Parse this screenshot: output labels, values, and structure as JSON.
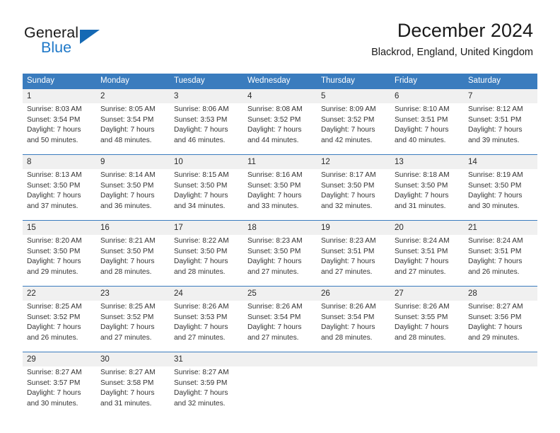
{
  "brand": {
    "name_top": "General",
    "name_bottom": "Blue",
    "accent_color": "#1569b4",
    "logo_icon": "triangle-icon"
  },
  "header": {
    "title": "December 2024",
    "subtitle": "Blackrod, England, United Kingdom"
  },
  "theme": {
    "header_blue": "#3a7cbe",
    "daynum_band": "#f0f0f0",
    "text": "#333333"
  },
  "calendar": {
    "day_headers": [
      "Sunday",
      "Monday",
      "Tuesday",
      "Wednesday",
      "Thursday",
      "Friday",
      "Saturday"
    ],
    "weeks": [
      [
        {
          "day": "1",
          "sunrise": "Sunrise: 8:03 AM",
          "sunset": "Sunset: 3:54 PM",
          "daylight_1": "Daylight: 7 hours",
          "daylight_2": "and 50 minutes."
        },
        {
          "day": "2",
          "sunrise": "Sunrise: 8:05 AM",
          "sunset": "Sunset: 3:54 PM",
          "daylight_1": "Daylight: 7 hours",
          "daylight_2": "and 48 minutes."
        },
        {
          "day": "3",
          "sunrise": "Sunrise: 8:06 AM",
          "sunset": "Sunset: 3:53 PM",
          "daylight_1": "Daylight: 7 hours",
          "daylight_2": "and 46 minutes."
        },
        {
          "day": "4",
          "sunrise": "Sunrise: 8:08 AM",
          "sunset": "Sunset: 3:52 PM",
          "daylight_1": "Daylight: 7 hours",
          "daylight_2": "and 44 minutes."
        },
        {
          "day": "5",
          "sunrise": "Sunrise: 8:09 AM",
          "sunset": "Sunset: 3:52 PM",
          "daylight_1": "Daylight: 7 hours",
          "daylight_2": "and 42 minutes."
        },
        {
          "day": "6",
          "sunrise": "Sunrise: 8:10 AM",
          "sunset": "Sunset: 3:51 PM",
          "daylight_1": "Daylight: 7 hours",
          "daylight_2": "and 40 minutes."
        },
        {
          "day": "7",
          "sunrise": "Sunrise: 8:12 AM",
          "sunset": "Sunset: 3:51 PM",
          "daylight_1": "Daylight: 7 hours",
          "daylight_2": "and 39 minutes."
        }
      ],
      [
        {
          "day": "8",
          "sunrise": "Sunrise: 8:13 AM",
          "sunset": "Sunset: 3:50 PM",
          "daylight_1": "Daylight: 7 hours",
          "daylight_2": "and 37 minutes."
        },
        {
          "day": "9",
          "sunrise": "Sunrise: 8:14 AM",
          "sunset": "Sunset: 3:50 PM",
          "daylight_1": "Daylight: 7 hours",
          "daylight_2": "and 36 minutes."
        },
        {
          "day": "10",
          "sunrise": "Sunrise: 8:15 AM",
          "sunset": "Sunset: 3:50 PM",
          "daylight_1": "Daylight: 7 hours",
          "daylight_2": "and 34 minutes."
        },
        {
          "day": "11",
          "sunrise": "Sunrise: 8:16 AM",
          "sunset": "Sunset: 3:50 PM",
          "daylight_1": "Daylight: 7 hours",
          "daylight_2": "and 33 minutes."
        },
        {
          "day": "12",
          "sunrise": "Sunrise: 8:17 AM",
          "sunset": "Sunset: 3:50 PM",
          "daylight_1": "Daylight: 7 hours",
          "daylight_2": "and 32 minutes."
        },
        {
          "day": "13",
          "sunrise": "Sunrise: 8:18 AM",
          "sunset": "Sunset: 3:50 PM",
          "daylight_1": "Daylight: 7 hours",
          "daylight_2": "and 31 minutes."
        },
        {
          "day": "14",
          "sunrise": "Sunrise: 8:19 AM",
          "sunset": "Sunset: 3:50 PM",
          "daylight_1": "Daylight: 7 hours",
          "daylight_2": "and 30 minutes."
        }
      ],
      [
        {
          "day": "15",
          "sunrise": "Sunrise: 8:20 AM",
          "sunset": "Sunset: 3:50 PM",
          "daylight_1": "Daylight: 7 hours",
          "daylight_2": "and 29 minutes."
        },
        {
          "day": "16",
          "sunrise": "Sunrise: 8:21 AM",
          "sunset": "Sunset: 3:50 PM",
          "daylight_1": "Daylight: 7 hours",
          "daylight_2": "and 28 minutes."
        },
        {
          "day": "17",
          "sunrise": "Sunrise: 8:22 AM",
          "sunset": "Sunset: 3:50 PM",
          "daylight_1": "Daylight: 7 hours",
          "daylight_2": "and 28 minutes."
        },
        {
          "day": "18",
          "sunrise": "Sunrise: 8:23 AM",
          "sunset": "Sunset: 3:50 PM",
          "daylight_1": "Daylight: 7 hours",
          "daylight_2": "and 27 minutes."
        },
        {
          "day": "19",
          "sunrise": "Sunrise: 8:23 AM",
          "sunset": "Sunset: 3:51 PM",
          "daylight_1": "Daylight: 7 hours",
          "daylight_2": "and 27 minutes."
        },
        {
          "day": "20",
          "sunrise": "Sunrise: 8:24 AM",
          "sunset": "Sunset: 3:51 PM",
          "daylight_1": "Daylight: 7 hours",
          "daylight_2": "and 27 minutes."
        },
        {
          "day": "21",
          "sunrise": "Sunrise: 8:24 AM",
          "sunset": "Sunset: 3:51 PM",
          "daylight_1": "Daylight: 7 hours",
          "daylight_2": "and 26 minutes."
        }
      ],
      [
        {
          "day": "22",
          "sunrise": "Sunrise: 8:25 AM",
          "sunset": "Sunset: 3:52 PM",
          "daylight_1": "Daylight: 7 hours",
          "daylight_2": "and 26 minutes."
        },
        {
          "day": "23",
          "sunrise": "Sunrise: 8:25 AM",
          "sunset": "Sunset: 3:52 PM",
          "daylight_1": "Daylight: 7 hours",
          "daylight_2": "and 27 minutes."
        },
        {
          "day": "24",
          "sunrise": "Sunrise: 8:26 AM",
          "sunset": "Sunset: 3:53 PM",
          "daylight_1": "Daylight: 7 hours",
          "daylight_2": "and 27 minutes."
        },
        {
          "day": "25",
          "sunrise": "Sunrise: 8:26 AM",
          "sunset": "Sunset: 3:54 PM",
          "daylight_1": "Daylight: 7 hours",
          "daylight_2": "and 27 minutes."
        },
        {
          "day": "26",
          "sunrise": "Sunrise: 8:26 AM",
          "sunset": "Sunset: 3:54 PM",
          "daylight_1": "Daylight: 7 hours",
          "daylight_2": "and 28 minutes."
        },
        {
          "day": "27",
          "sunrise": "Sunrise: 8:26 AM",
          "sunset": "Sunset: 3:55 PM",
          "daylight_1": "Daylight: 7 hours",
          "daylight_2": "and 28 minutes."
        },
        {
          "day": "28",
          "sunrise": "Sunrise: 8:27 AM",
          "sunset": "Sunset: 3:56 PM",
          "daylight_1": "Daylight: 7 hours",
          "daylight_2": "and 29 minutes."
        }
      ],
      [
        {
          "day": "29",
          "sunrise": "Sunrise: 8:27 AM",
          "sunset": "Sunset: 3:57 PM",
          "daylight_1": "Daylight: 7 hours",
          "daylight_2": "and 30 minutes."
        },
        {
          "day": "30",
          "sunrise": "Sunrise: 8:27 AM",
          "sunset": "Sunset: 3:58 PM",
          "daylight_1": "Daylight: 7 hours",
          "daylight_2": "and 31 minutes."
        },
        {
          "day": "31",
          "sunrise": "Sunrise: 8:27 AM",
          "sunset": "Sunset: 3:59 PM",
          "daylight_1": "Daylight: 7 hours",
          "daylight_2": "and 32 minutes."
        },
        {
          "day": "",
          "sunrise": "",
          "sunset": "",
          "daylight_1": "",
          "daylight_2": ""
        },
        {
          "day": "",
          "sunrise": "",
          "sunset": "",
          "daylight_1": "",
          "daylight_2": ""
        },
        {
          "day": "",
          "sunrise": "",
          "sunset": "",
          "daylight_1": "",
          "daylight_2": ""
        },
        {
          "day": "",
          "sunrise": "",
          "sunset": "",
          "daylight_1": "",
          "daylight_2": ""
        }
      ]
    ]
  }
}
